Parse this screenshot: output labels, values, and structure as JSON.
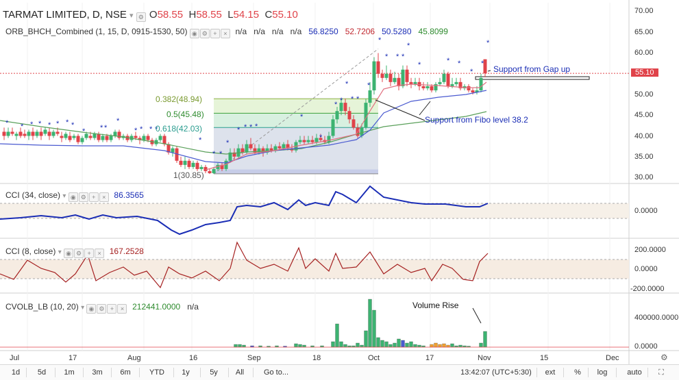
{
  "header": {
    "symbol": "TARMAT LIMITED, D, NSE",
    "open_label": "O",
    "open": "58.55",
    "high_label": "H",
    "high": "58.55",
    "low_label": "L",
    "low": "54.15",
    "close_label": "C",
    "close": "55.10"
  },
  "indicator_orb": {
    "title": "ORB_BHCH_Combined (1, 15, D, 0915-1530, 50)",
    "na1": "n/a",
    "na2": "n/a",
    "na3": "n/a",
    "na4": "n/a",
    "v1": "56.8250",
    "v2": "52.7206",
    "v3": "50.5280",
    "v4": "45.8099"
  },
  "fib": {
    "l0382": "0.382(48.94)",
    "l05": "0.5(45.48)",
    "l0618": "0.618(42.03)",
    "l1": "1(30.85)"
  },
  "annotations": {
    "gap": "Support from Gap up",
    "fibo": "Support from Fibo level 38.2",
    "volume": "Volume Rise"
  },
  "price_axis": [
    "70.00",
    "65.00",
    "60.00",
    "55.10",
    "50.00",
    "45.00",
    "40.00",
    "35.00",
    "30.00"
  ],
  "price_tag": "55.10",
  "cci34": {
    "title": "CCI (34, close)",
    "value": "86.3565",
    "axis": [
      "0.0000"
    ]
  },
  "cci8": {
    "title": "CCI (8, close)",
    "value": "167.2528",
    "axis": [
      "200.0000",
      "0.0000",
      "-200.0000"
    ]
  },
  "cvol": {
    "title": "CVOLB_LB (10, 20)",
    "value": "212441.0000",
    "na": "n/a",
    "axis": [
      "400000.0000",
      "0.0000"
    ]
  },
  "x_axis": [
    "Jul",
    "17",
    "Aug",
    "16",
    "Sep",
    "18",
    "Oct",
    "17",
    "Nov",
    "15",
    "Dec"
  ],
  "toolbar": {
    "ranges": [
      "1d",
      "5d",
      "1m",
      "3m",
      "6m",
      "YTD",
      "1y",
      "5y",
      "All"
    ],
    "goto": "Go to...",
    "time": "13:42:07 (UTC+5:30)",
    "pct": "%",
    "log": "log",
    "auto": "auto",
    "ext": "ext"
  },
  "colors": {
    "up": "#3cb371",
    "down": "#e0434a",
    "cci": "#1a2db5",
    "cci8": "#a52020"
  }
}
